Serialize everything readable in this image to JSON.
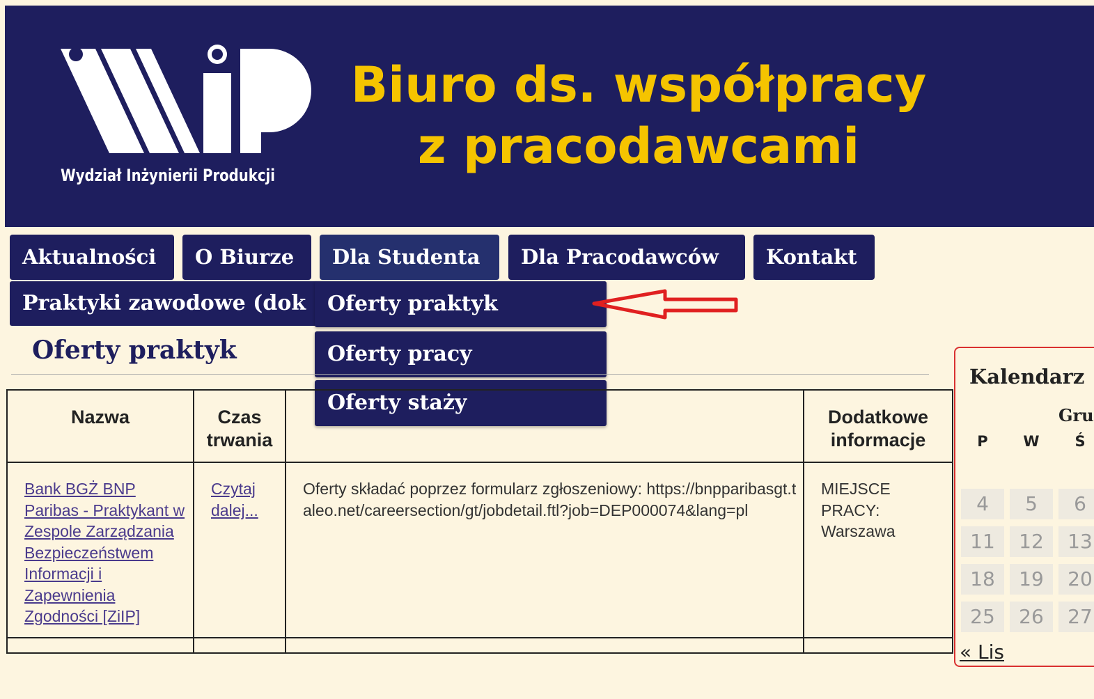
{
  "header": {
    "logo_caption": "Wydział Inżynierii Produkcji",
    "title_line1": "Biuro ds. współpracy",
    "title_line2": "z pracodawcami",
    "background": "#1e1e5e",
    "title_color": "#f5c400"
  },
  "nav": {
    "tabs": [
      {
        "label": "Aktualności"
      },
      {
        "label": "O Biurze"
      },
      {
        "label": "Dla Studenta"
      },
      {
        "label": "Dla Pracodawców"
      },
      {
        "label": "Kontakt"
      }
    ],
    "sub_item": "Praktyki zawodowe (dok",
    "dropdown": [
      "Oferty praktyk",
      "Oferty pracy",
      "Oferty staży"
    ]
  },
  "page": {
    "title": "Oferty praktyk"
  },
  "table": {
    "headers": [
      "Nazwa",
      "Czas trwania",
      "",
      "Dodatkowe informacje"
    ],
    "rows": [
      {
        "name": "Bank BGŻ BNP Paribas - Praktykant w Zespole Zarządzania Bezpieczeństwem Informacji i Zapewnienia Zgodności [ZiIP]",
        "duration": "Czytaj dalej...",
        "description": "Oferty składać poprzez formularz zgłoszeniowy: https://bnpparibasgt.taleo.net/careersection/gt/jobdetail.ftl?job=DEP000074&lang=pl",
        "extra": "MIEJSCE PRACY: Warszawa"
      }
    ]
  },
  "calendar": {
    "title": "Kalendarz",
    "month": "Gru",
    "day_names": [
      "P",
      "W",
      "Ś"
    ],
    "weeks": [
      [
        "4",
        "5",
        "6"
      ],
      [
        "11",
        "12",
        "13"
      ],
      [
        "18",
        "19",
        "20"
      ],
      [
        "25",
        "26",
        "27"
      ]
    ],
    "prev_link": "« Lis",
    "border_color": "#d93030"
  },
  "annotation": {
    "arrow_color": "#e02020"
  }
}
